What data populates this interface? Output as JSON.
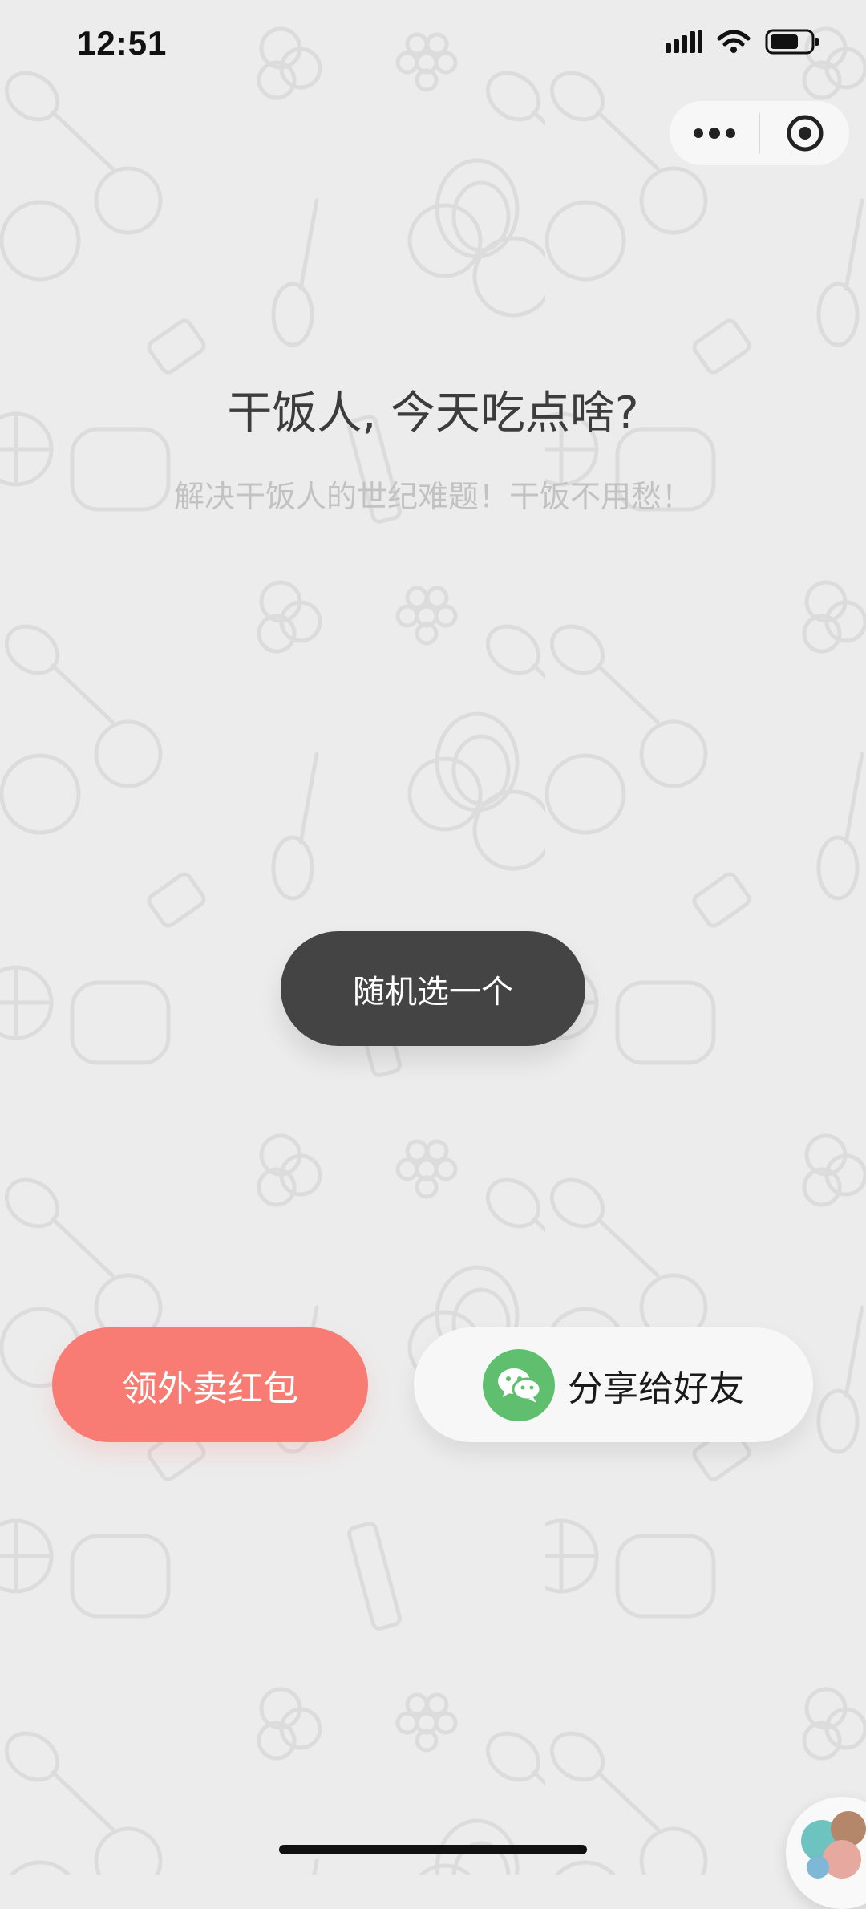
{
  "status_bar": {
    "time": "12:51",
    "icons": [
      "signal-icon",
      "wifi-icon",
      "battery-icon"
    ]
  },
  "capsule": {
    "icons": [
      "more-icon",
      "close-target-icon"
    ]
  },
  "main": {
    "title": "干饭人, 今天吃点啥?",
    "subtitle": "解决干饭人的世纪难题！干饭不用愁！",
    "random_button_label": "随机选一个"
  },
  "actions": {
    "coupon_label": "领外卖红包",
    "share_label": "分享给好友",
    "share_icon": "wechat-icon"
  },
  "colors": {
    "background": "#ececec",
    "primary_button": "#444444",
    "coupon_button": "#f87c73",
    "share_button": "#f7f7f7",
    "wechat_green": "#5fbf6f"
  }
}
